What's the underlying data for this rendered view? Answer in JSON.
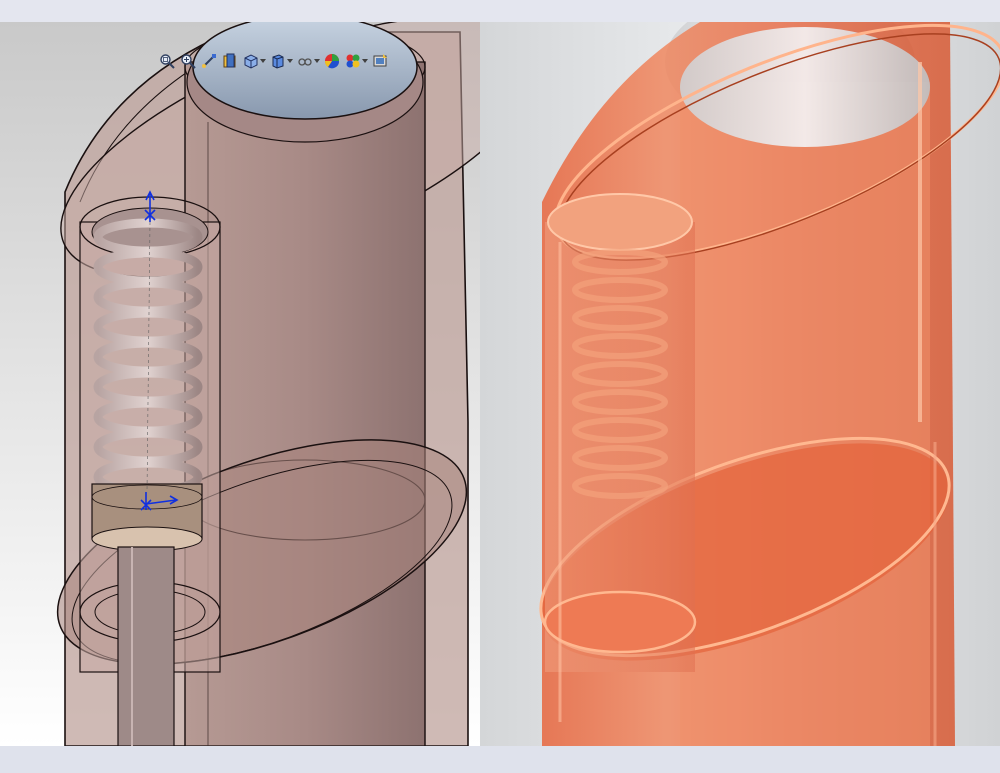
{
  "window": {
    "panels": [
      "cad-wireframe-view",
      "photo-render-view"
    ]
  },
  "toolbar": {
    "items": [
      {
        "icon": "zoom-to-fit-icon",
        "has_dropdown": false
      },
      {
        "icon": "zoom-to-area-icon",
        "has_dropdown": false
      },
      {
        "icon": "previous-view-icon",
        "has_dropdown": false
      },
      {
        "icon": "section-view-icon",
        "has_dropdown": false
      },
      {
        "icon": "view-orientation-icon",
        "has_dropdown": true
      },
      {
        "icon": "display-style-icon",
        "has_dropdown": true
      },
      {
        "icon": "hide-show-items-icon",
        "has_dropdown": true
      },
      {
        "icon": "edit-appearance-icon",
        "has_dropdown": false
      },
      {
        "icon": "apply-scene-icon",
        "has_dropdown": true
      },
      {
        "icon": "view-settings-icon",
        "has_dropdown": false
      }
    ]
  },
  "colors": {
    "cad_background_top": "#c9c9c9",
    "cad_background_bottom": "#ffffff",
    "cad_body": "#b89a92",
    "cad_outline": "#1a1010",
    "cad_spring": "#a8908e",
    "cad_plunger_top": "#9eb0c6",
    "render_background": "#e2e4e6",
    "render_body": "#e8663e",
    "render_highlight": "#ffb08a",
    "render_plunger": "#e6e6e8"
  }
}
